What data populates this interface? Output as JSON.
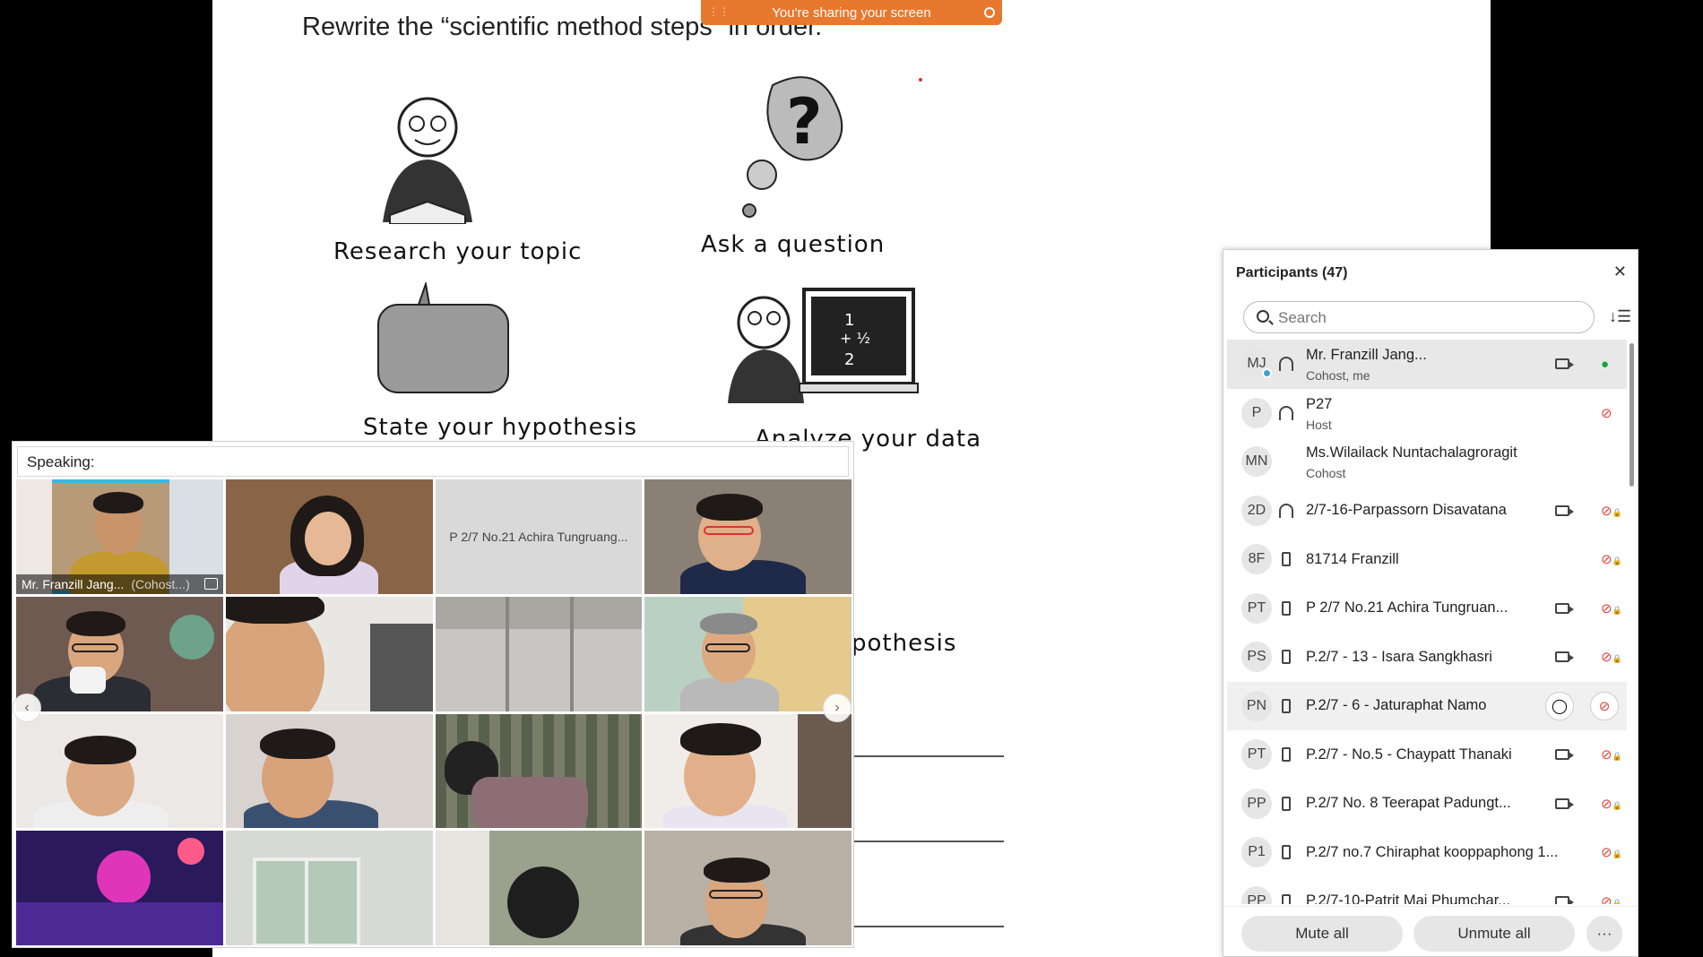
{
  "share_banner": {
    "text": "You're sharing your screen"
  },
  "worksheet": {
    "title": "Rewrite the “scientific method steps” in order.",
    "labels": {
      "research": "Research your topic",
      "question": "Ask a question",
      "hypothesis": "State your hypothesis",
      "analyze": "Analyze your data",
      "partial": "pothesis"
    }
  },
  "video_panel": {
    "speaking_label": "Speaking:",
    "tiles": [
      {
        "name": "Mr. Franzill Jang...",
        "role": "(Cohost...)"
      },
      {
        "name": ""
      },
      {
        "name": "P 2/7 No.21 Achira Tungruang..."
      },
      {
        "name": ""
      }
    ]
  },
  "participants": {
    "title": "Participants (47)",
    "search_placeholder": "Search",
    "rows": [
      {
        "initials": "MJ",
        "name": "Mr. Franzill Jang...",
        "role": "Cohost, me"
      },
      {
        "initials": "P",
        "name": "P27",
        "role": "Host"
      },
      {
        "initials": "MN",
        "name": "Ms.Wilailack Nuntachalagroragit",
        "role": "Cohost"
      },
      {
        "initials": "2D",
        "name": "2/7-16-Parpassorn Disavatana"
      },
      {
        "initials": "8F",
        "name": "81714 Franzill"
      },
      {
        "initials": "PT",
        "name": "P 2/7 No.21 Achira Tungruan..."
      },
      {
        "initials": "PS",
        "name": "P.2/7 - 13 - Isara Sangkhasri"
      },
      {
        "initials": "PN",
        "name": "P.2/7 - 6 - Jaturaphat Namo"
      },
      {
        "initials": "PT",
        "name": "P.2/7 - No.5 - Chaypatt Thanaki"
      },
      {
        "initials": "PP",
        "name": "P.2/7 No. 8 Teerapat Padungt..."
      },
      {
        "initials": "P1",
        "name": "P.2/7 no.7 Chiraphat kooppaphong 1..."
      },
      {
        "initials": "PP",
        "name": "P.2/7-10-Patrit Mai Phumchar..."
      }
    ],
    "mute_all": "Mute all",
    "unmute_all": "Unmute all",
    "more": "···"
  }
}
